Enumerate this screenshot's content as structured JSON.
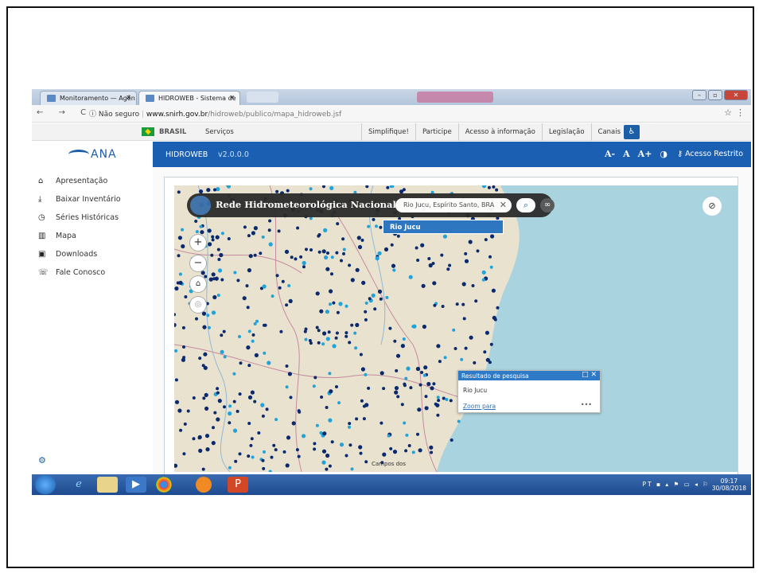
{
  "browser": {
    "tabs": [
      {
        "label": "Monitoramento — Agên",
        "close": "✕"
      },
      {
        "label": "HIDROWEB - Sistema de",
        "close": "✕"
      }
    ],
    "nav_glyphs": "← → C",
    "security_label": "ⓘ Não seguro",
    "url_host": "www.snirh.gov.br",
    "url_path": "/hidroweb/publico/mapa_hidroweb.jsf"
  },
  "gov_bar": {
    "brasil": "BRASIL",
    "servicos": "Serviços",
    "links": [
      "Simplifique!",
      "Participe",
      "Acesso à informação",
      "Legislação",
      "Canais"
    ]
  },
  "app": {
    "logo": "ANA",
    "title": "HIDROWEB",
    "version": "v2.0.0.0",
    "font_controls": [
      "A-",
      "A",
      "A+",
      "◑"
    ],
    "restricted": "Acesso Restrito"
  },
  "sidebar": {
    "items": [
      {
        "icon": "briefcase-icon",
        "glyph": "⌂",
        "label": "Apresentação"
      },
      {
        "icon": "download-icon",
        "glyph": "⤓",
        "label": "Baixar Inventário"
      },
      {
        "icon": "clock-icon",
        "glyph": "◷",
        "label": "Séries Históricas"
      },
      {
        "icon": "map-icon",
        "glyph": "▥",
        "label": "Mapa"
      },
      {
        "icon": "downloads-icon",
        "glyph": "▣",
        "label": "Downloads"
      },
      {
        "icon": "phone-icon",
        "glyph": "☏",
        "label": "Fale Conosco"
      }
    ]
  },
  "map": {
    "header_title": "Rede Hidrometeorológica Nacional",
    "search_value": "Rio Jucu, Espírito Santo, BRA",
    "suggestion": "Rio Jucu",
    "popup": {
      "title": "Resultado de pesquisa",
      "result": "Rio Jucu",
      "zoom_link": "Zoom para",
      "more": "•••"
    },
    "place_labels": [
      "Campos dos"
    ]
  },
  "taskbar": {
    "language": "PT",
    "time": "09:17",
    "date": "30/08/2018"
  }
}
